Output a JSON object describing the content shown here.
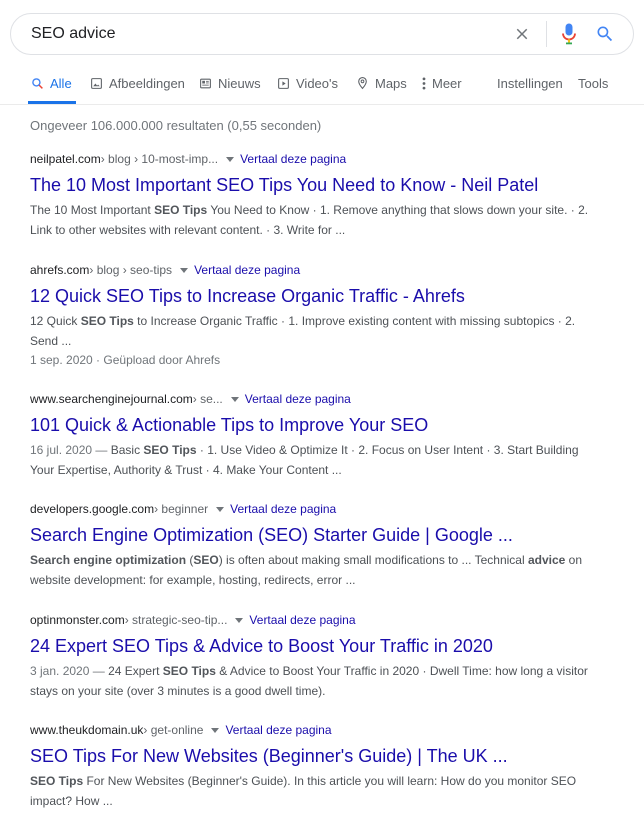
{
  "search": {
    "query": "SEO advice"
  },
  "tabs": [
    {
      "label": "Alle",
      "icon": "search-icon"
    },
    {
      "label": "Afbeeldingen",
      "icon": "image-icon"
    },
    {
      "label": "Nieuws",
      "icon": "news-icon"
    },
    {
      "label": "Video's",
      "icon": "video-icon"
    },
    {
      "label": "Maps",
      "icon": "map-pin-icon"
    },
    {
      "label": "Meer",
      "icon": "more-vert-icon"
    },
    {
      "label": "Instellingen"
    },
    {
      "label": "Tools"
    }
  ],
  "stats": "Ongeveer 106.000.000 resultaten (0,55 seconden)",
  "translate_label": "Vertaal deze pagina",
  "results": [
    {
      "domain": "neilpatel.com",
      "path": " › blog › 10-most-imp...",
      "title": "The 10 Most Important SEO Tips You Need to Know - Neil Patel",
      "snippet": [
        {
          "t": "The 10 Most Important "
        },
        {
          "b": "SEO Tips"
        },
        {
          "t": " You Need to Know · 1. Remove anything that slows down your site. · 2. Link to other websites with relevant content. · 3. Write for ..."
        }
      ]
    },
    {
      "domain": "ahrefs.com",
      "path": " › blog › seo-tips",
      "title": "12 Quick SEO Tips to Increase Organic Traffic - Ahrefs",
      "snippet": [
        {
          "t": "12 Quick "
        },
        {
          "b": "SEO Tips"
        },
        {
          "t": " to Increase Organic Traffic · 1. Improve existing content with missing subtopics · 2. Send ..."
        }
      ],
      "meta": "1 sep. 2020 · Geüpload door Ahrefs"
    },
    {
      "domain": "www.searchenginejournal.com",
      "path": " › se...",
      "title": "101 Quick & Actionable Tips to Improve Your SEO",
      "snippet": [
        {
          "d": "16 jul. 2020 — "
        },
        {
          "t": "Basic "
        },
        {
          "b": "SEO Tips"
        },
        {
          "t": " · 1. Use Video & Optimize It · 2. Focus on User Intent · 3. Start Building Your Expertise, Authority & Trust · 4. Make Your Content ..."
        }
      ]
    },
    {
      "domain": "developers.google.com",
      "path": " › beginner",
      "title": "Search Engine Optimization (SEO) Starter Guide | Google ...",
      "snippet": [
        {
          "b": "Search engine optimization"
        },
        {
          "t": " ("
        },
        {
          "b": "SEO"
        },
        {
          "t": ") is often about making small modifications to ... Technical "
        },
        {
          "b": "advice"
        },
        {
          "t": " on website development: for example, hosting, redirects, error ..."
        }
      ]
    },
    {
      "domain": "optinmonster.com",
      "path": " › strategic-seo-tip...",
      "title": "24 Expert SEO Tips & Advice to Boost Your Traffic in 2020",
      "snippet": [
        {
          "d": "3 jan. 2020 — "
        },
        {
          "t": "24 Expert "
        },
        {
          "b": "SEO Tips"
        },
        {
          "t": " & Advice to Boost Your Traffic in 2020 · Dwell Time: how long a visitor stays on your site (over 3 minutes is a good dwell time)."
        }
      ]
    },
    {
      "domain": "www.theukdomain.uk",
      "path": " › get-online",
      "title": "SEO Tips For New Websites (Beginner's Guide) | The UK ...",
      "snippet": [
        {
          "b": "SEO Tips"
        },
        {
          "t": " For New Websites (Beginner's Guide). In this article you will learn: How do you monitor SEO impact? How ..."
        }
      ]
    }
  ]
}
